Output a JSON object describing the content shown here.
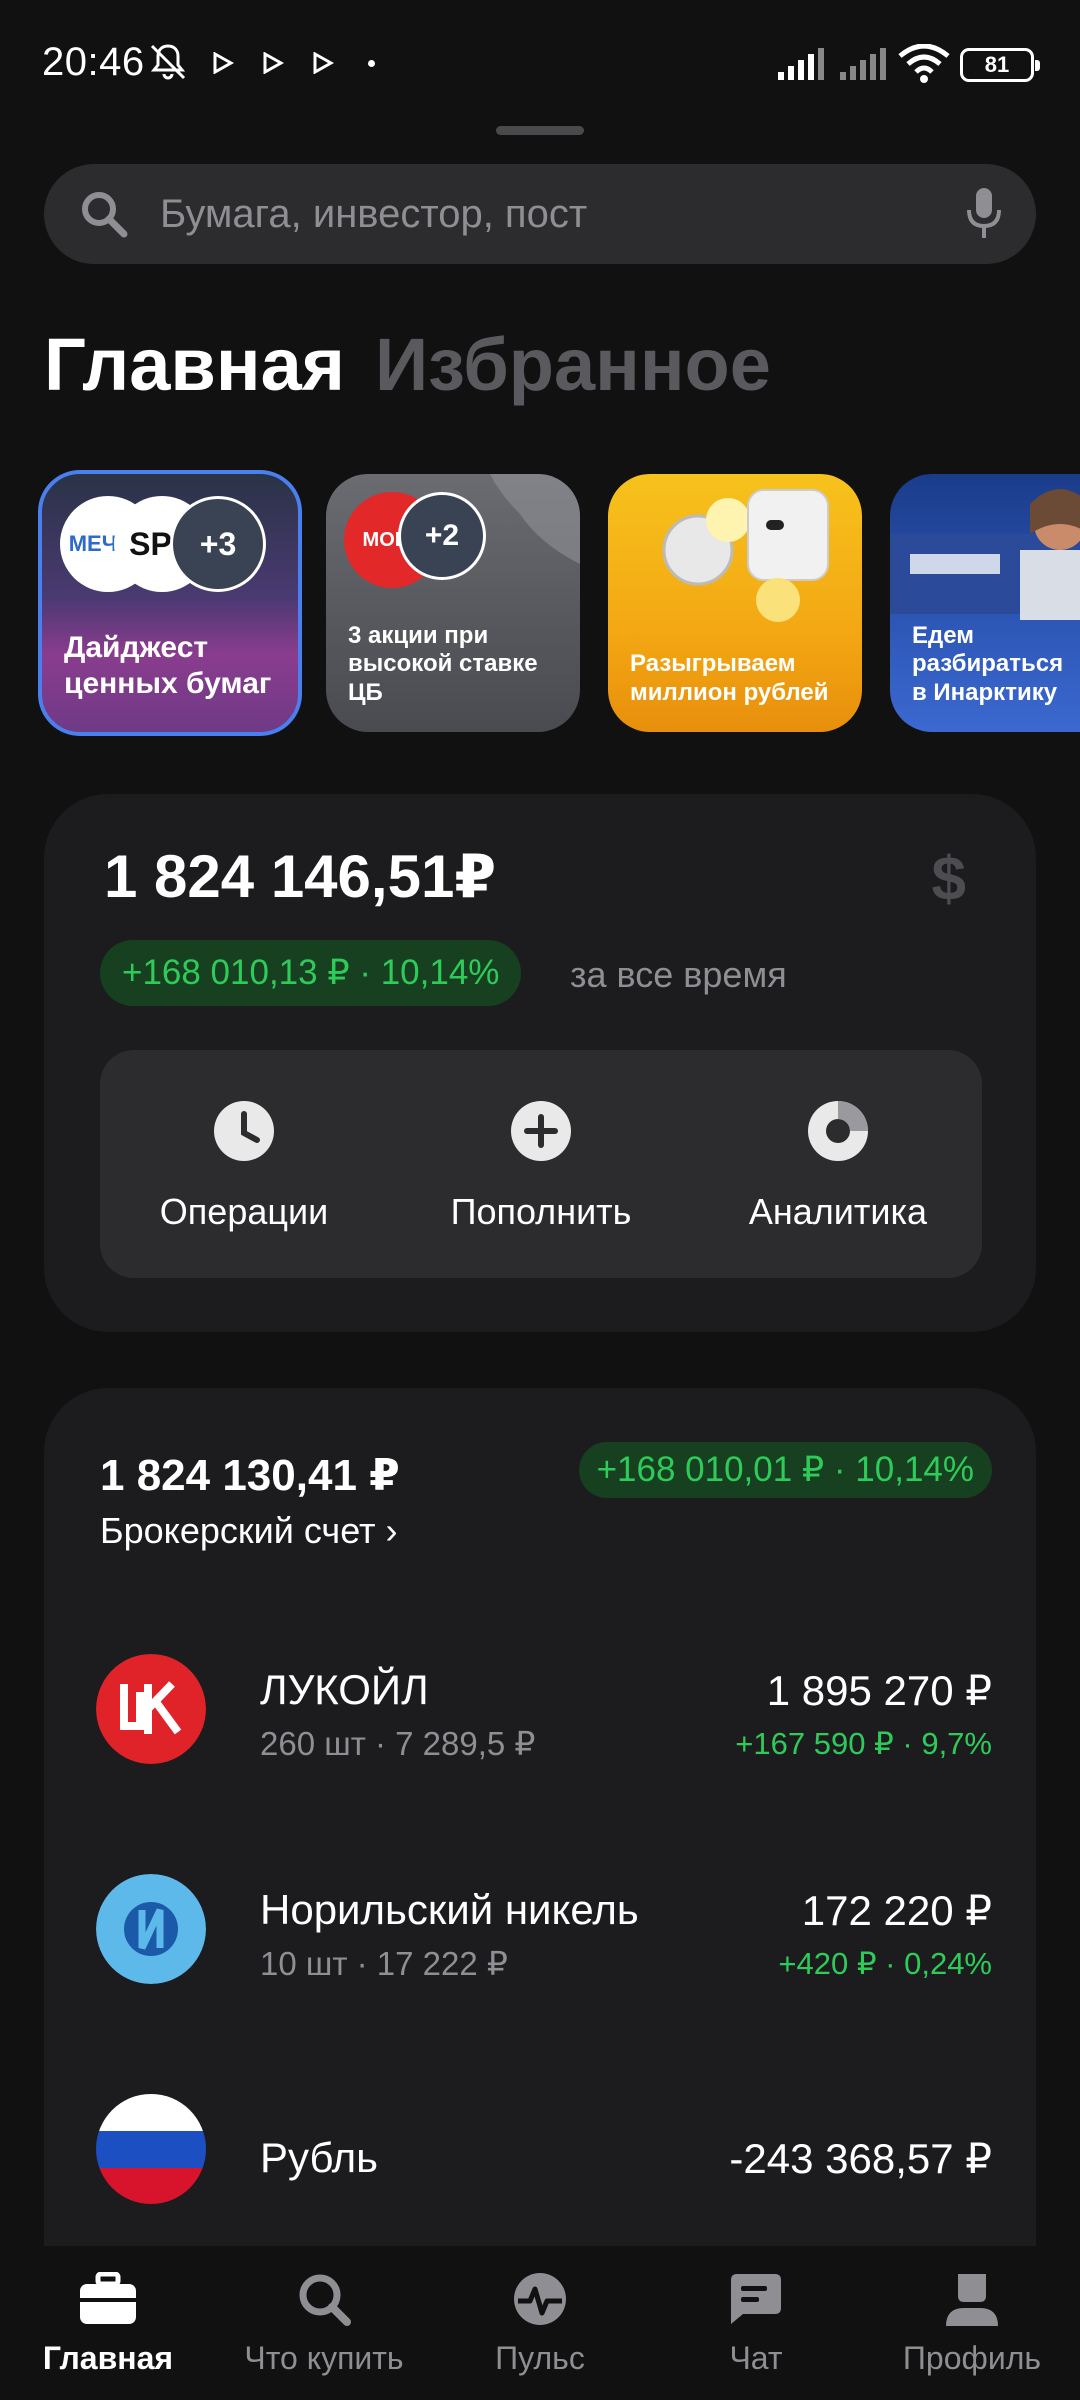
{
  "status_bar": {
    "time": "20:46",
    "battery": "81",
    "icons": [
      "mute-icon",
      "play-icon",
      "play-icon",
      "play-icon",
      "dot-icon",
      "signal-icon",
      "signal-icon",
      "wifi-icon",
      "battery-icon"
    ]
  },
  "search": {
    "placeholder": "Бумага, инвестор, пост"
  },
  "tabs": {
    "main": "Главная",
    "favorites": "Избранное"
  },
  "stories": [
    {
      "label": "Дайджест ценных бумаг",
      "badge_count": "+3",
      "logos": [
        "МЕЧЕЛ",
        "SPB"
      ]
    },
    {
      "label": "3 акции при высокой ставке ЦБ",
      "badge_count": "+2",
      "logos": [
        "МОЕХ"
      ]
    },
    {
      "label": "Разыгрываем миллион рублей"
    },
    {
      "label": "Едем разбираться в Инарктику"
    }
  ],
  "portfolio": {
    "total": "1 824 146,51₽",
    "currency_toggle": "$",
    "gain": "+168 010,13 ₽ · 10,14%",
    "gain_period": "за все время",
    "actions": [
      {
        "label": "Операции",
        "icon": "clock-icon"
      },
      {
        "label": "Пополнить",
        "icon": "plus-icon"
      },
      {
        "label": "Аналитика",
        "icon": "pie-icon"
      }
    ]
  },
  "broker_account": {
    "total": "1 824 130,41 ₽",
    "name": "Брокерский счет ›",
    "gain": "+168 010,01 ₽ · 10,14%",
    "positions": [
      {
        "name": "ЛУКОЙЛ",
        "details": "260 шт · 7 289,5 ₽",
        "value": "1 895 270 ₽",
        "change": "+167 590 ₽ · 9,7%"
      },
      {
        "name": "Норильский никель",
        "details": "10 шт · 17 222 ₽",
        "value": "172 220 ₽",
        "change": "+420 ₽ · 0,24%"
      },
      {
        "name": "Рубль",
        "details": "",
        "value": "-243 368,57 ₽",
        "change": ""
      }
    ]
  },
  "bottom_nav": [
    {
      "label": "Главная",
      "icon": "briefcase-icon",
      "active": true
    },
    {
      "label": "Что купить",
      "icon": "search-icon"
    },
    {
      "label": "Пульс",
      "icon": "pulse-icon"
    },
    {
      "label": "Чат",
      "icon": "chat-icon"
    },
    {
      "label": "Профиль",
      "icon": "profile-icon"
    }
  ],
  "colors": {
    "background": "#111112",
    "card": "#1c1c1e",
    "positive": "#2fcb5a",
    "positive_bg": "#16401f",
    "muted": "#8e8e93",
    "accent_border": "#4a7ff0"
  }
}
